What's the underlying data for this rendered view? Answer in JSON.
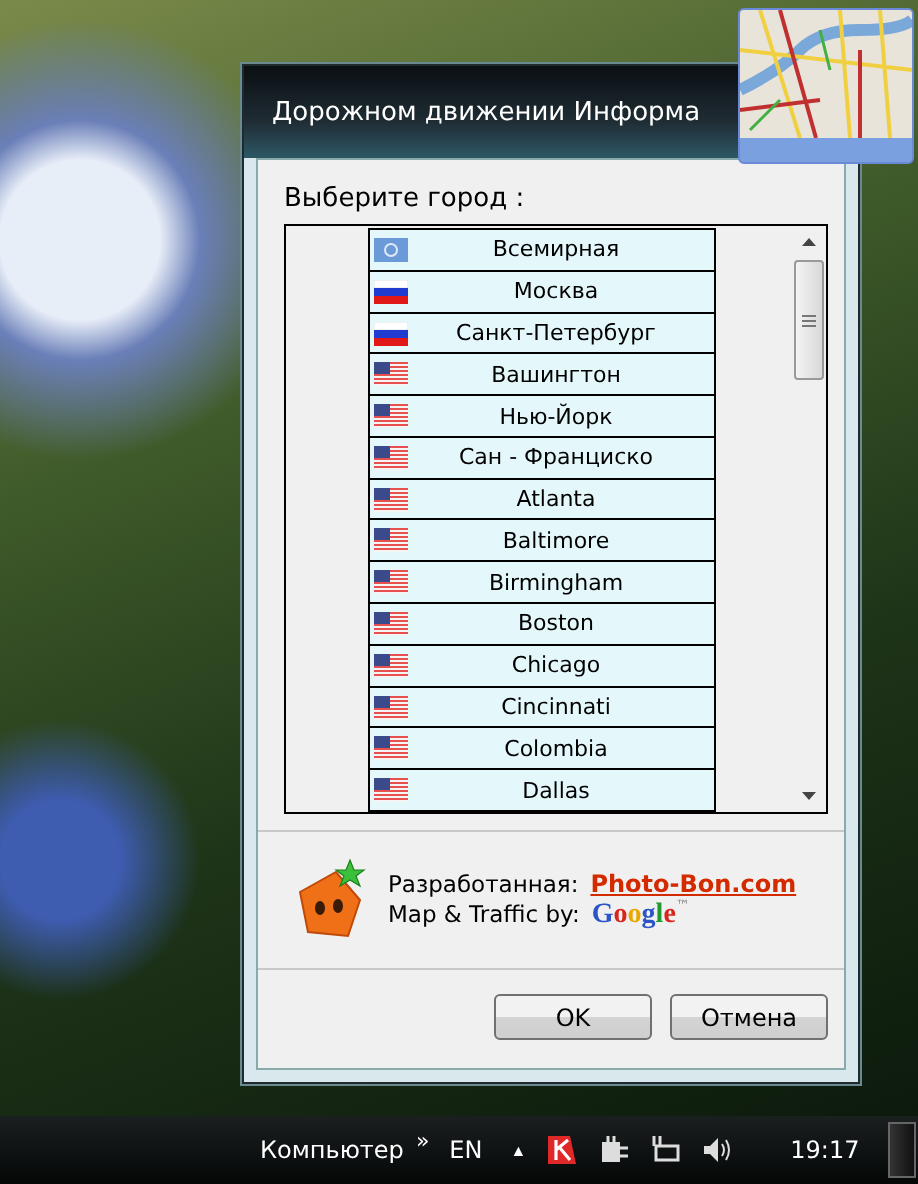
{
  "window": {
    "title": "Дорожном движении Информа"
  },
  "prompt": "Выберите город :",
  "cities": [
    {
      "name": "Всемирная",
      "kind": "world"
    },
    {
      "name": "Москва",
      "kind": "ru"
    },
    {
      "name": "Санкт-Петербург",
      "kind": "ru"
    },
    {
      "name": "Вашингтон",
      "kind": "us"
    },
    {
      "name": "Нью-Йорк",
      "kind": "us"
    },
    {
      "name": "Сан - Франциско",
      "kind": "us"
    },
    {
      "name": "Atlanta",
      "kind": "us"
    },
    {
      "name": "Baltimore",
      "kind": "us"
    },
    {
      "name": "Birmingham",
      "kind": "us"
    },
    {
      "name": "Boston",
      "kind": "us"
    },
    {
      "name": "Chicago",
      "kind": "us"
    },
    {
      "name": "Cincinnati",
      "kind": "us"
    },
    {
      "name": "Colombia",
      "kind": "us"
    },
    {
      "name": "Dallas",
      "kind": "us"
    }
  ],
  "credits": {
    "developer_label": "Разработанная:",
    "developer_link": "Photo-Bon.com",
    "map_label": "Map & Traffic by:",
    "map_provider": "Google",
    "trademark": "™"
  },
  "buttons": [
    "OK",
    "Отмена"
  ],
  "taskbar": {
    "toolbar": "Компьютер",
    "chevron": "»",
    "language": "EN",
    "tray_arrow": "▲",
    "clock": "19:17"
  }
}
